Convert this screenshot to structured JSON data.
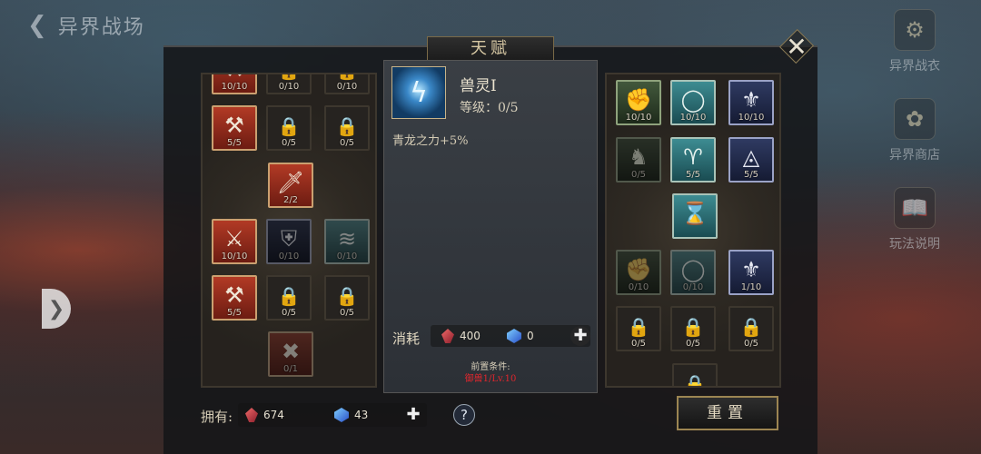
{
  "header": {
    "back_label": "异界战场",
    "title": "天赋"
  },
  "side_menu": [
    {
      "label": "异界战衣",
      "icon": "armor-icon"
    },
    {
      "label": "异界商店",
      "icon": "shop-icon"
    },
    {
      "label": "玩法说明",
      "icon": "book-icon"
    }
  ],
  "left_tree": {
    "slots": [
      {
        "level": "10/10",
        "style": "red",
        "icon": "axe-icon",
        "glyph": "⚒"
      },
      {
        "level": "0/10",
        "style": "locked",
        "icon": "lock-icon",
        "glyph": "🔒"
      },
      {
        "level": "0/10",
        "style": "locked",
        "icon": "lock-icon",
        "glyph": "🔒"
      },
      {
        "level": "5/5",
        "style": "red",
        "icon": "axe-icon",
        "glyph": "⚒"
      },
      {
        "level": "0/5",
        "style": "locked",
        "icon": "lock-icon",
        "glyph": "🔒"
      },
      {
        "level": "0/5",
        "style": "locked",
        "icon": "lock-icon",
        "glyph": "🔒"
      },
      {
        "level": "2/2",
        "style": "red",
        "icon": "sword-icon",
        "glyph": "🗡"
      },
      {
        "level": "10/10",
        "style": "red",
        "icon": "sword-icon",
        "glyph": "⚔"
      },
      {
        "level": "0/10",
        "style": "navy dim",
        "icon": "shield-icon",
        "glyph": "⛨"
      },
      {
        "level": "0/10",
        "style": "teal dim",
        "icon": "wing-icon",
        "glyph": "≋"
      },
      {
        "level": "5/5",
        "style": "red",
        "icon": "axe-icon",
        "glyph": "⚒"
      },
      {
        "level": "0/5",
        "style": "locked",
        "icon": "lock-icon",
        "glyph": "🔒"
      },
      {
        "level": "0/5",
        "style": "locked",
        "icon": "lock-icon",
        "glyph": "🔒"
      },
      {
        "level": "0/1",
        "style": "red dim",
        "icon": "weapon-icon",
        "glyph": "✖"
      }
    ]
  },
  "right_tree": {
    "slots": [
      {
        "level": "10/10",
        "style": "green",
        "icon": "fist-icon",
        "glyph": "✊"
      },
      {
        "level": "10/10",
        "style": "teal",
        "icon": "ring-icon",
        "glyph": "◯"
      },
      {
        "level": "10/10",
        "style": "navy",
        "icon": "knot-icon",
        "glyph": "⚜"
      },
      {
        "level": "0/5",
        "style": "green dim",
        "icon": "rider-icon",
        "glyph": "♞"
      },
      {
        "level": "5/5",
        "style": "teal",
        "icon": "horns-icon",
        "glyph": "♈"
      },
      {
        "level": "5/5",
        "style": "navy",
        "icon": "amulet-icon",
        "glyph": "◬"
      },
      {
        "level": "",
        "style": "teal",
        "icon": "hourglass-icon",
        "glyph": "⌛"
      },
      {
        "level": "0/10",
        "style": "green dim",
        "icon": "fist-icon",
        "glyph": "✊"
      },
      {
        "level": "0/10",
        "style": "teal dim",
        "icon": "ring-icon",
        "glyph": "◯"
      },
      {
        "level": "1/10",
        "style": "navy",
        "icon": "knot-icon",
        "glyph": "⚜"
      },
      {
        "level": "0/5",
        "style": "locked",
        "icon": "lock-icon",
        "glyph": "🔒"
      },
      {
        "level": "0/5",
        "style": "locked",
        "icon": "lock-icon",
        "glyph": "🔒"
      },
      {
        "level": "0/5",
        "style": "locked",
        "icon": "lock-icon",
        "glyph": "🔒"
      },
      {
        "level": "",
        "style": "locked",
        "icon": "lock-icon",
        "glyph": "🔒"
      }
    ]
  },
  "detail": {
    "name": "兽灵I",
    "level_text": "等级：0/5",
    "description": "青龙之力+5%",
    "cost_label": "消耗",
    "cost_red": "400",
    "cost_blue": "0",
    "prereq_title": "前置条件:",
    "prereq_value": "御兽1/Lv.10"
  },
  "footer": {
    "own_label": "拥有:",
    "own_red": "674",
    "own_blue": "43",
    "help_label": "?",
    "reset_label": "重置"
  },
  "colors": {
    "prereq": "#e0262d",
    "accent_gold": "#9c8552"
  }
}
